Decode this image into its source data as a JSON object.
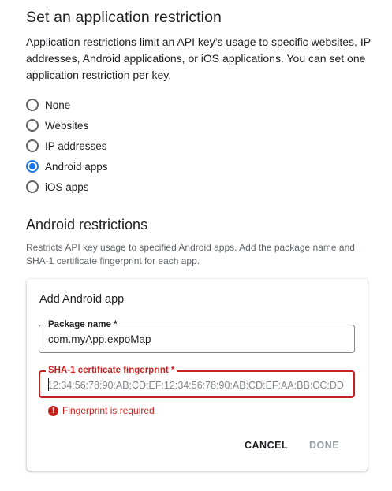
{
  "section_title": "Set an application restriction",
  "section_description": "Application restrictions limit an API key’s usage to specific websites, IP addresses, Android applications, or iOS applications. You can set one application restriction per key.",
  "restriction_options": [
    {
      "label": "None",
      "checked": false
    },
    {
      "label": "Websites",
      "checked": false
    },
    {
      "label": "IP addresses",
      "checked": false
    },
    {
      "label": "Android apps",
      "checked": true
    },
    {
      "label": "iOS apps",
      "checked": false
    }
  ],
  "android": {
    "title": "Android restrictions",
    "description": "Restricts API key usage to specified Android apps. Add the package name and SHA-1 certificate fingerprint for each app."
  },
  "dialog": {
    "title": "Add Android app",
    "package_label": "Package name *",
    "package_value": "com.myApp.expoMap",
    "sha_label": "SHA-1 certificate fingerprint *",
    "sha_placeholder": "12:34:56:78:90:AB:CD:EF:12:34:56:78:90:AB:CD:EF:AA:BB:CC:DD",
    "sha_value": "",
    "error_icon": "error-icon",
    "error_text": "Fingerprint is required",
    "cancel_label": "CANCEL",
    "done_label": "DONE"
  },
  "colors": {
    "accent": "#1a73e8",
    "error": "#c5221f",
    "disabled": "#9aa0a6"
  }
}
